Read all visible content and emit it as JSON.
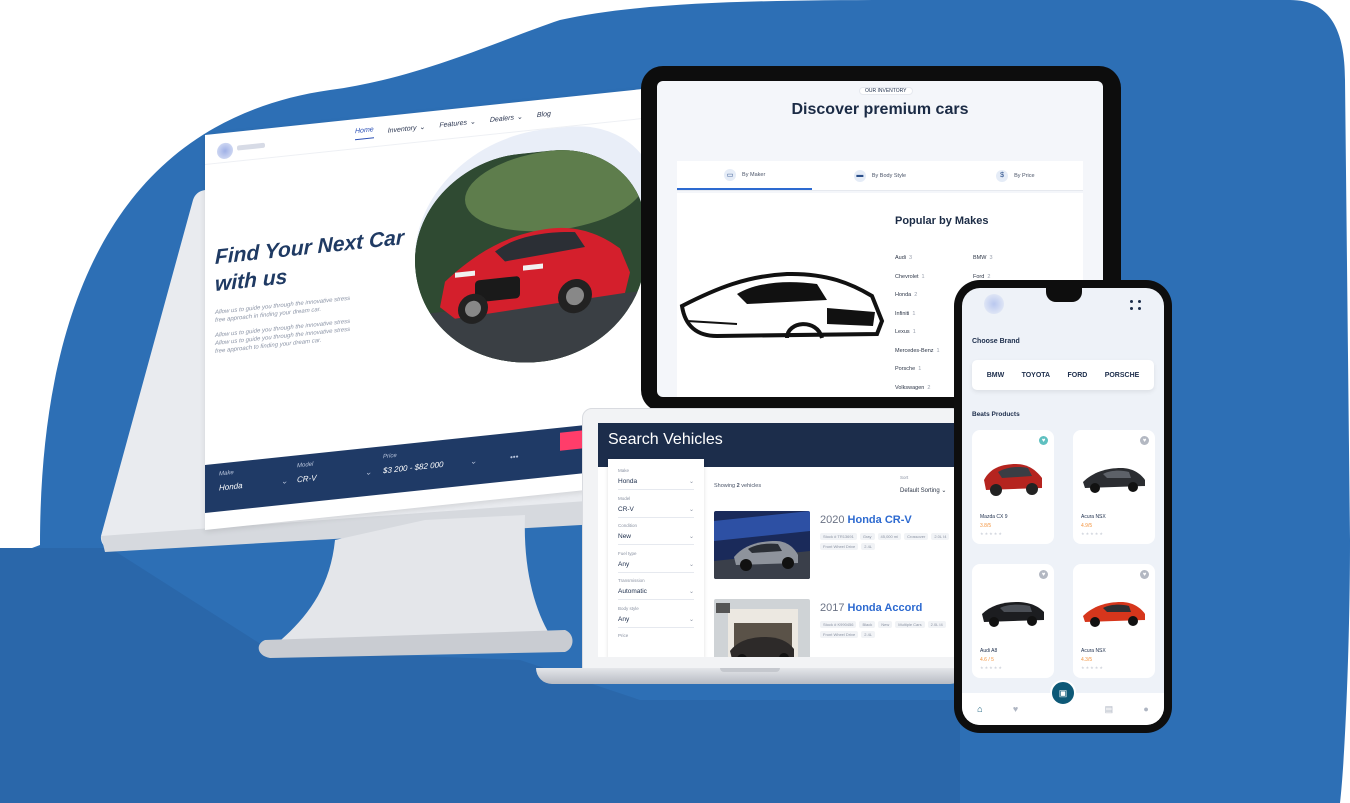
{
  "colors": {
    "background_blue": "#2d6fb5",
    "navy": "#1f3a66",
    "accent_pink": "#ff3d6a",
    "accent_blue": "#2d6ad0",
    "teal": "#0e5977"
  },
  "desktop": {
    "nav": [
      "Home",
      "Inventory",
      "Features",
      "Dealers",
      "Blog"
    ],
    "hero_title_line1": "Find Your Next Car",
    "hero_title_line2": "with us",
    "paragraphs": [
      "Allow us to guide you through the innovative stress",
      "free approach in finding your dream car.",
      "Allow us to guide you through the innovative stress",
      "Allow us to guide you through the innovative stress",
      "free approach to finding your dream car."
    ],
    "search": {
      "make_label": "Make",
      "make_value": "Honda",
      "model_label": "Model",
      "model_value": "CR-V",
      "price_label": "Price",
      "price_value": "$3 200 - $82 000",
      "more": "•••",
      "search_button": "SEARCH"
    }
  },
  "tablet": {
    "badge": "OUR INVENTORY",
    "title": "Discover premium cars",
    "tabs": [
      {
        "label": "By Maker",
        "icon": "car-icon"
      },
      {
        "label": "By Body Style",
        "icon": "suv-icon"
      },
      {
        "label": "By Price",
        "icon": "dollar-icon"
      }
    ],
    "popular_title": "Popular by Makes",
    "makes_left": [
      "Audi",
      "Chevrolet",
      "Honda",
      "Infiniti",
      "Lexus",
      "Mercedes-Benz",
      "Porsche",
      "Volkswagen"
    ],
    "makes_left_counts": [
      "3",
      "1",
      "2",
      "1",
      "1",
      "1",
      "1",
      "2"
    ],
    "makes_right": [
      "BMW",
      "Ford"
    ],
    "makes_right_counts": [
      "3",
      "2"
    ]
  },
  "laptop": {
    "title": "Search Vehicles",
    "filters": [
      {
        "label": "Make",
        "value": "Honda"
      },
      {
        "label": "Model",
        "value": "CR-V"
      },
      {
        "label": "Condition",
        "value": "New"
      },
      {
        "label": "Fuel type",
        "value": "Any"
      },
      {
        "label": "Transmission",
        "value": "Automatic"
      },
      {
        "label": "Body style",
        "value": "Any"
      },
      {
        "label": "Price",
        "value": ""
      }
    ],
    "showing_prefix": "Showing",
    "showing_count": "2",
    "showing_suffix": "vehicles",
    "sort_label": "Sort",
    "sort_value": "Default Sorting",
    "vehicles": [
      {
        "year": "2020",
        "make_model": "Honda CR-V",
        "chips": [
          "Stock # TR13691",
          "Gray",
          "45,000 mi",
          "Crossover",
          "2.0L I4",
          "Front Wheel Drive",
          "2.4L"
        ]
      },
      {
        "year": "2017",
        "make_model": "Honda Accord",
        "chips": [
          "Stock # K990456",
          "Black",
          "New",
          "Multiple Cars",
          "2.0L I4",
          "Front Wheel Drive",
          "2.4L"
        ]
      }
    ]
  },
  "phone": {
    "choose_brand": "Choose Brand",
    "brands": [
      "BMW",
      "TOYOTA",
      "FORD",
      "PORSCHE"
    ],
    "best_products": "Beats Products",
    "products": [
      {
        "name": "Mazda  CX 9",
        "rating": "3.8/5"
      },
      {
        "name": "Acura NSX",
        "rating": "4.9/5"
      },
      {
        "name": "Audi A8",
        "rating": "4.6 / 5"
      },
      {
        "name": "Acura NSX",
        "rating": "4.3/5"
      }
    ],
    "tabbar": [
      "home-icon",
      "heart-icon",
      "bag-icon",
      "clipboard-icon",
      "user-icon"
    ]
  }
}
